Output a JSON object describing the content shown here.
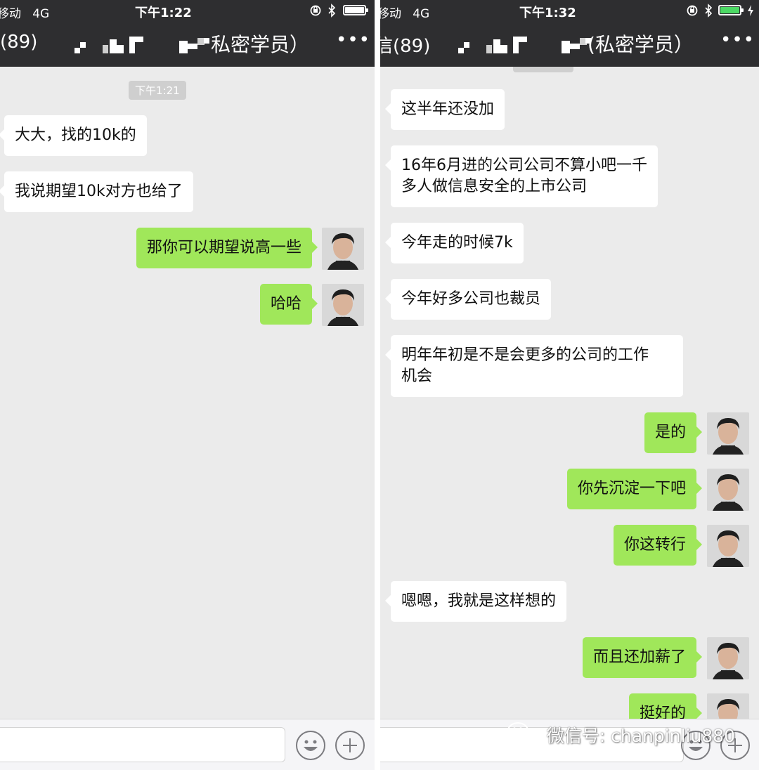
{
  "colors": {
    "header_bg": "#2e2e30",
    "chat_bg": "#ebebeb",
    "incoming_bubble": "#ffffff",
    "outgoing_bubble": "#a0e75a",
    "battery_green": "#4cd964"
  },
  "left": {
    "status": {
      "carrier": "移动",
      "network": "4G",
      "time": "下午1:22",
      "battery": "full",
      "icons": [
        "orientation-lock-icon",
        "bluetooth-icon",
        "battery-icon"
      ]
    },
    "nav": {
      "back_label": "(89)",
      "title": "私密学员）",
      "more": "•••"
    },
    "timestamp": "下午1:21",
    "messages": [
      {
        "side": "in",
        "text": "大大，找的10k的"
      },
      {
        "side": "in",
        "text": "我说期望10k对方也给了"
      },
      {
        "side": "out",
        "text": "那你可以期望说高一些"
      },
      {
        "side": "out",
        "text": "哈哈"
      }
    ]
  },
  "right": {
    "status": {
      "carrier": "移动",
      "network": "4G",
      "time": "下午1:32",
      "battery": "charging",
      "icons": [
        "orientation-lock-icon",
        "bluetooth-icon",
        "battery-icon",
        "charging-bolt-icon"
      ]
    },
    "nav": {
      "back_label": "信(89)",
      "title": "(私密学员）",
      "more": "•••"
    },
    "messages": [
      {
        "side": "in",
        "text": "这半年还没加"
      },
      {
        "side": "in",
        "text": "16年6月进的公司公司不算小吧一千\n多人做信息安全的上市公司"
      },
      {
        "side": "in",
        "text": "今年走的时候7k"
      },
      {
        "side": "in",
        "text": "今年好多公司也裁员"
      },
      {
        "side": "in",
        "text": "明年年初是不是会更多的公司的工作\n机会"
      },
      {
        "side": "out",
        "text": "是的"
      },
      {
        "side": "out",
        "text": "你先沉淀一下吧"
      },
      {
        "side": "out",
        "text": "你这转行"
      },
      {
        "side": "in",
        "text": "嗯嗯，我就是这样想的"
      },
      {
        "side": "out",
        "text": "而且还加薪了"
      },
      {
        "side": "out",
        "text": "挺好的"
      }
    ]
  },
  "watermark": {
    "text": "微信号: chanpinliu880",
    "icon": "wechat-icon"
  }
}
